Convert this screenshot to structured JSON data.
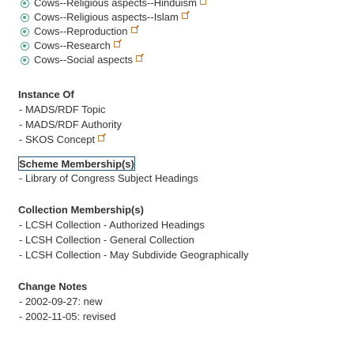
{
  "narrower_terms": [
    {
      "label": "Cows--Religious aspects--Hinduism",
      "icon": "topic-icon",
      "link_icon": "external-link-icon"
    },
    {
      "label": "Cows--Religious aspects--Islam",
      "icon": "topic-icon",
      "link_icon": "external-link-icon"
    },
    {
      "label": "Cows--Reproduction",
      "icon": "topic-icon",
      "link_icon": "external-link-icon"
    },
    {
      "label": "Cows--Research",
      "icon": "topic-icon",
      "link_icon": "external-link-icon"
    },
    {
      "label": "Cows--Social aspects",
      "icon": "topic-icon",
      "link_icon": "external-link-icon"
    }
  ],
  "instance_of": {
    "heading": "Instance Of",
    "items": [
      "- MADS/RDF Topic",
      "- MADS/RDF Authority",
      "- SKOS Concept"
    ],
    "link_icon_on_item": 2
  },
  "scheme_membership": {
    "heading": "Scheme Membership(s)",
    "items": [
      "- Library of Congress Subject Headings"
    ]
  },
  "collection_membership": {
    "heading": "Collection Membership(s)",
    "items": [
      "- LCSH Collection - Authorized Headings",
      "- LCSH Collection - General Collection",
      "- LCSH Collection - May Subdivide Geographically"
    ]
  },
  "change_notes": {
    "heading": "Change Notes",
    "items": [
      "- 2002-09-27: new",
      "- 2002-11-05: revised"
    ]
  },
  "colors": {
    "topic_icon": "#56a389",
    "external_link": "#c77a2c",
    "focus_outline": "#1f4e79",
    "text": "#333333"
  }
}
